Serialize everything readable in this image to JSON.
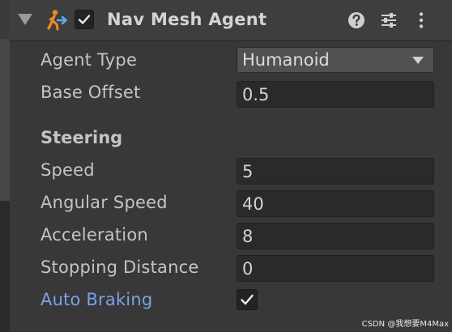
{
  "component": {
    "title": "Nav Mesh Agent",
    "enabled": true,
    "icons": [
      "foldout-arrow-icon",
      "nav-mesh-agent-icon",
      "help-icon",
      "presets-icon",
      "more-options-icon"
    ]
  },
  "properties": {
    "agent_type": {
      "label": "Agent Type",
      "value": "Humanoid"
    },
    "base_offset": {
      "label": "Base Offset",
      "value": "0.5"
    }
  },
  "steering": {
    "title": "Steering",
    "speed": {
      "label": "Speed",
      "value": "5"
    },
    "angular_speed": {
      "label": "Angular Speed",
      "value": "40"
    },
    "acceleration": {
      "label": "Acceleration",
      "value": "8"
    },
    "stopping_distance": {
      "label": "Stopping Distance",
      "value": "0"
    },
    "auto_braking": {
      "label": "Auto Braking",
      "checked": true
    }
  },
  "watermark": "CSDN @我想要M4Max",
  "colors": {
    "panel_bg": "#383838",
    "header_bg": "#3e3e3e",
    "field_bg": "#2a2a2a",
    "dropdown_bg": "#515151",
    "label_text": "#c4c4c4",
    "highlight_label": "#7ba2e6",
    "agent_icon_orange": "#f08a24",
    "agent_icon_blue": "#5aa9f0"
  }
}
